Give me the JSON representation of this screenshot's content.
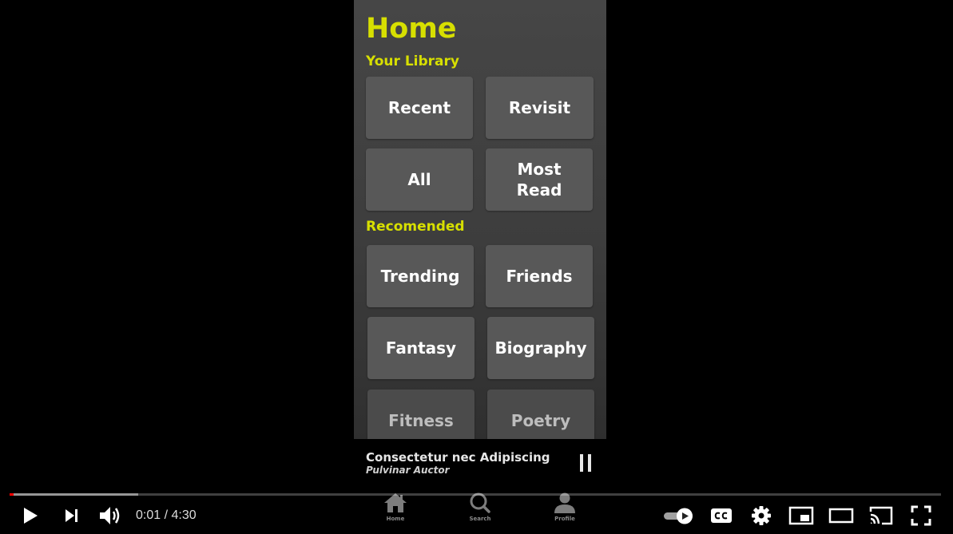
{
  "app": {
    "title": "Home",
    "sections": [
      {
        "title": "Your Library",
        "tiles": [
          "Recent",
          "Revisit",
          "All",
          "Most Read"
        ]
      },
      {
        "title": "Recomended",
        "tiles": [
          "Trending",
          "Friends",
          "Fantasy",
          "Biography",
          "Fitness",
          "Poetry"
        ]
      }
    ]
  },
  "mini_player": {
    "title": "Consectetur nec Adipiscing",
    "author": "Pulvinar Auctor",
    "pause_icon": "pause-icon"
  },
  "bottom_nav": [
    {
      "label": "Home",
      "icon": "house-icon"
    },
    {
      "label": "Search",
      "icon": "magnifier-icon"
    },
    {
      "label": "Profile",
      "icon": "person-icon"
    }
  ],
  "player": {
    "current_time": "0:01",
    "separator": " / ",
    "duration": "4:30",
    "played_fraction": 0.004,
    "buffered_fraction": 0.138,
    "autoplay": "on",
    "colors": {
      "played": "#ff0000",
      "accent": "#d7df00"
    }
  }
}
